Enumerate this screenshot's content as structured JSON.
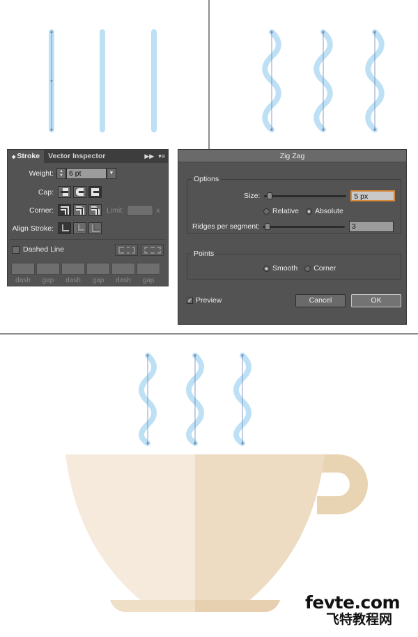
{
  "stroke_panel": {
    "tabs": [
      "Stroke",
      "Vector Inspector"
    ],
    "tab_arrow_icon": "double-chevron-right-icon",
    "menu_icon": "panel-menu-icon",
    "weight_label": "Weight:",
    "weight_value": "6 pt",
    "cap_label": "Cap:",
    "corner_label": "Corner:",
    "limit_label": "Limit:",
    "limit_unit": "x",
    "align_label": "Align Stroke:",
    "dashed_label": "Dashed Line",
    "dash_labels": [
      "dash",
      "gap",
      "dash",
      "gap",
      "dash",
      "gap"
    ]
  },
  "zigzag": {
    "title": "Zig Zag",
    "options_label": "Options",
    "size_label": "Size:",
    "size_value": "5 px",
    "size_slider_fraction": 0.03,
    "relative_label": "Relative",
    "absolute_label": "Absolute",
    "selected_mode": "Absolute",
    "ridges_label": "Ridges per segment:",
    "ridges_value": "3",
    "ridges_slider_fraction": 0.03,
    "points_label": "Points",
    "smooth_label": "Smooth",
    "corner_label": "Corner",
    "selected_points": "Smooth",
    "preview_label": "Preview",
    "preview_checked": true,
    "cancel_label": "Cancel",
    "ok_label": "OK"
  },
  "colors": {
    "steam_blue": "#bde0f5",
    "path_blue": "#6b86b5",
    "cup_light": "#f5eadb",
    "cup_dark": "#eddbc2",
    "handle": "#e8d3b3",
    "saucer_light": "#efdfc6",
    "saucer_dark": "#e6d0af"
  },
  "watermark": {
    "main": "fevte.com",
    "sub": "飞特教程网"
  }
}
